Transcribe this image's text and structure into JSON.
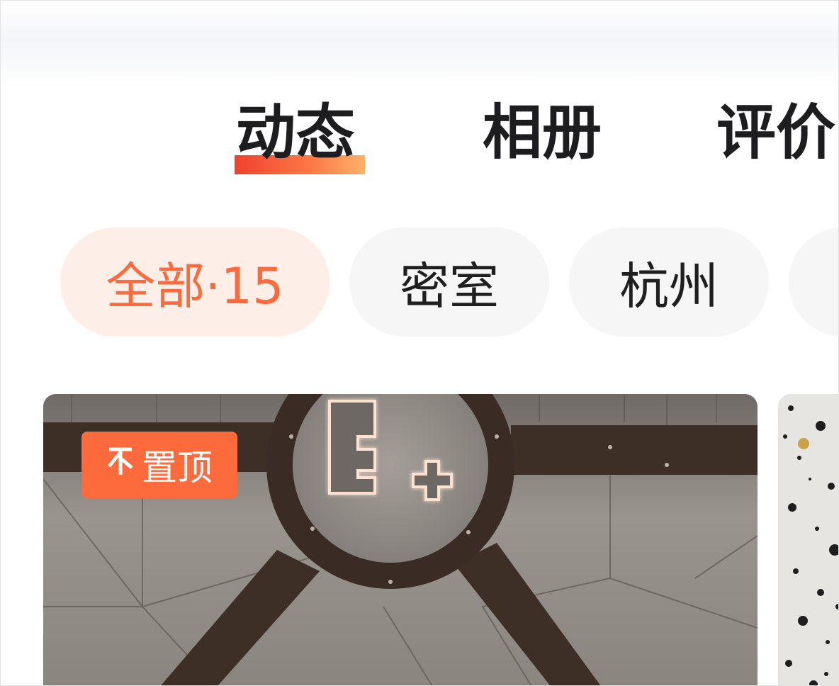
{
  "tabs": [
    {
      "label": "动态",
      "active": true
    },
    {
      "label": "相册",
      "active": false
    },
    {
      "label": "评价",
      "active": false
    }
  ],
  "filters": [
    {
      "label": "全部·15",
      "active": true
    },
    {
      "label": "密室",
      "active": false
    },
    {
      "label": "杭州",
      "active": false
    },
    {
      "label": "",
      "active": false
    }
  ],
  "posts": [
    {
      "badge": "置顶",
      "badge_icon": "pin-icon",
      "image": "ceiling-logo-photo"
    },
    {
      "image": "terrazzo-photo"
    }
  ],
  "colors": {
    "accent": "#fd6a3c",
    "chip_active_bg": "#fdeee7",
    "chip_bg": "#f6f6f7",
    "tab_indicator_start": "#f2412f",
    "tab_indicator_end": "#ffb06a"
  }
}
